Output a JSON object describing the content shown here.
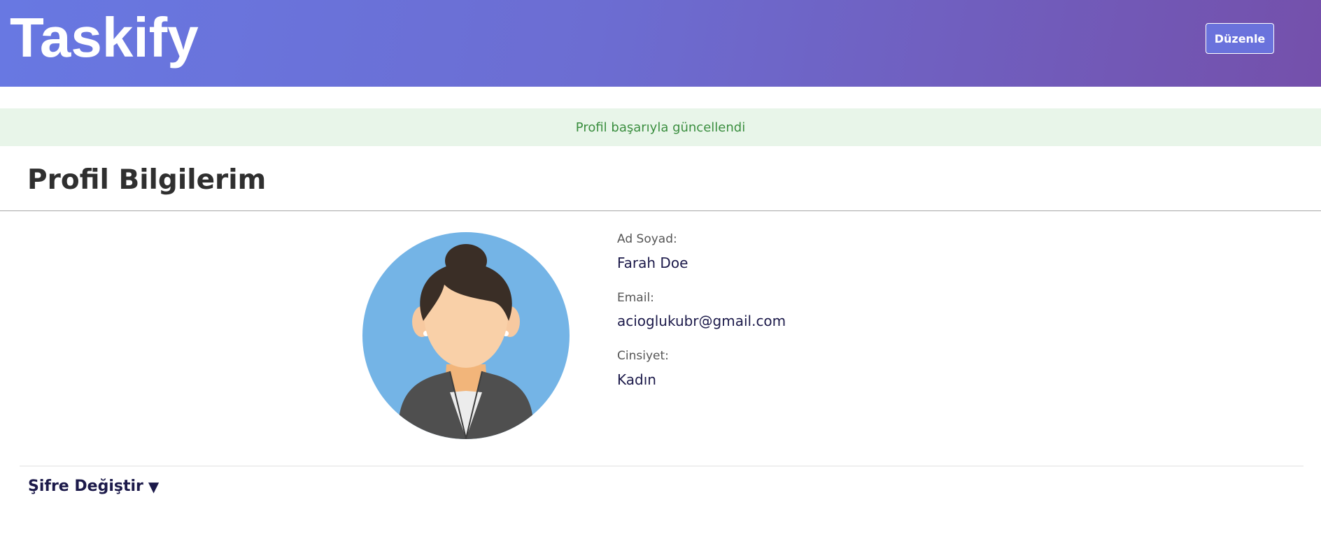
{
  "header": {
    "brand": "Taskify",
    "edit_label": "Düzenle"
  },
  "alert": {
    "message": "Profil başarıyla güncellendi"
  },
  "page": {
    "title": "Profil Bilgilerim"
  },
  "profile": {
    "fields": [
      {
        "label": "Ad Soyad:",
        "value": "Farah Doe"
      },
      {
        "label": "Email:",
        "value": "acioglukubr@gmail.com"
      },
      {
        "label": "Cinsiyet:",
        "value": "Kadın"
      }
    ],
    "avatar_icon": "female-avatar-icon"
  },
  "password": {
    "toggle_label": "Şifre Değiştir",
    "toggle_icon": "triangle-down-icon"
  },
  "colors": {
    "header_gradient_start": "#6878e2",
    "header_gradient_end": "#7450ab",
    "alert_bg": "#e8f5e9",
    "alert_text": "#3a8e3f",
    "value_text": "#1c1a4a"
  }
}
